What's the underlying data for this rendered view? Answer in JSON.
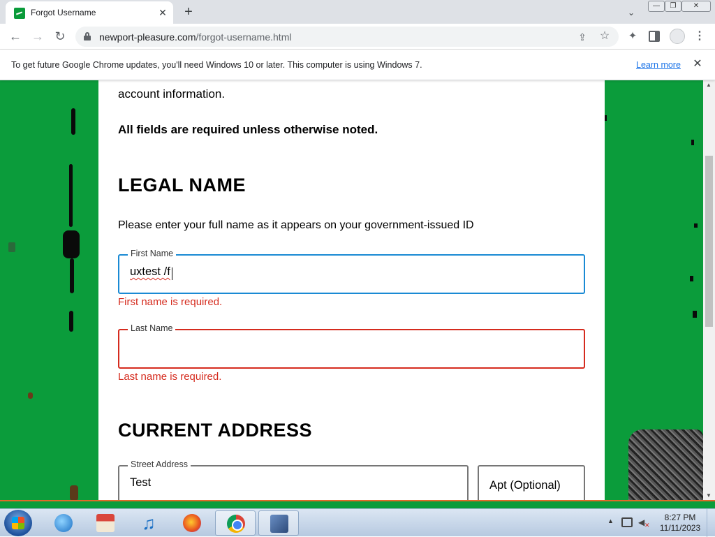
{
  "tab": {
    "title": "Forgot Username",
    "close": "✕",
    "new_tab": "+",
    "search": "⌄"
  },
  "window": {
    "minimize": "—",
    "maximize": "❐",
    "close": "✕"
  },
  "toolbar": {
    "back": "←",
    "forward": "→",
    "reload": "↻",
    "url_host": "newport-pleasure.com",
    "url_path": "/forgot-username.html",
    "share": "⇪",
    "star": "☆",
    "extensions": "✦",
    "menu": "⋮"
  },
  "infobar": {
    "message": "To get future Google Chrome updates, you'll need Windows 10 or later. This computer is using Windows 7.",
    "link": "Learn more",
    "close": "✕"
  },
  "page": {
    "intro_tail": "account information.",
    "required_note": "All fields are required unless otherwise noted.",
    "legal_name": {
      "title": "LEGAL NAME",
      "description": "Please enter your full name as it appears on your government-issued ID",
      "first_name": {
        "label": "First Name",
        "value": "uxtest /f",
        "error": "First name is required."
      },
      "last_name": {
        "label": "Last Name",
        "value": "",
        "error": "Last name is required."
      }
    },
    "current_address": {
      "title": "CURRENT ADDRESS",
      "street": {
        "label": "Street Address",
        "value": "Test"
      },
      "apt": {
        "placeholder": "Apt (Optional)"
      }
    }
  },
  "scrollbar": {
    "up": "▲",
    "down": "▼"
  },
  "taskbar": {
    "music_glyph": "♫",
    "volume_glyph": "◀",
    "mute_glyph": "✕",
    "tray_arrow": "▲",
    "time": "8:27 PM",
    "date": "11/11/2023"
  },
  "colors": {
    "page_background": "#0b9c3b",
    "error": "#d52b1e",
    "focus": "#1a8ad4",
    "link": "#1a73e8"
  }
}
